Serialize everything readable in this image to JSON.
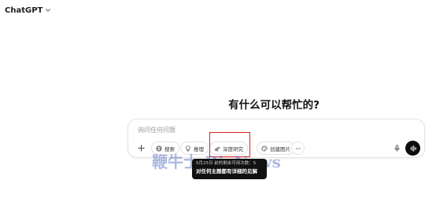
{
  "header": {
    "model_name": "ChatGPT",
    "chevron_icon": "chevron-down-icon"
  },
  "main": {
    "greeting": "有什么可以帮忙的?"
  },
  "composer": {
    "placeholder": "询问任何问题",
    "value": "",
    "add_icon": "plus-icon",
    "tools": [
      {
        "label": "搜索",
        "icon": "globe-icon"
      },
      {
        "label": "推理",
        "icon": "lightbulb-icon"
      },
      {
        "label": "深度研究",
        "icon": "telescope-icon"
      },
      {
        "label": "创建图片",
        "icon": "palette-icon"
      }
    ],
    "more_icon": "more-horizontal-icon",
    "mic_icon": "microphone-icon",
    "voice_icon": "voice-mode-icon"
  },
  "tooltip": {
    "line1": "5月25日 前的剩余可用次数：5",
    "line2": "对任何主题都有详细的见解"
  },
  "watermark": {
    "text": "鞭牛士 BiaNews"
  },
  "colors": {
    "highlight": "#e02020",
    "tooltip_bg": "#111111",
    "voice_button": "#0d0d0d"
  }
}
